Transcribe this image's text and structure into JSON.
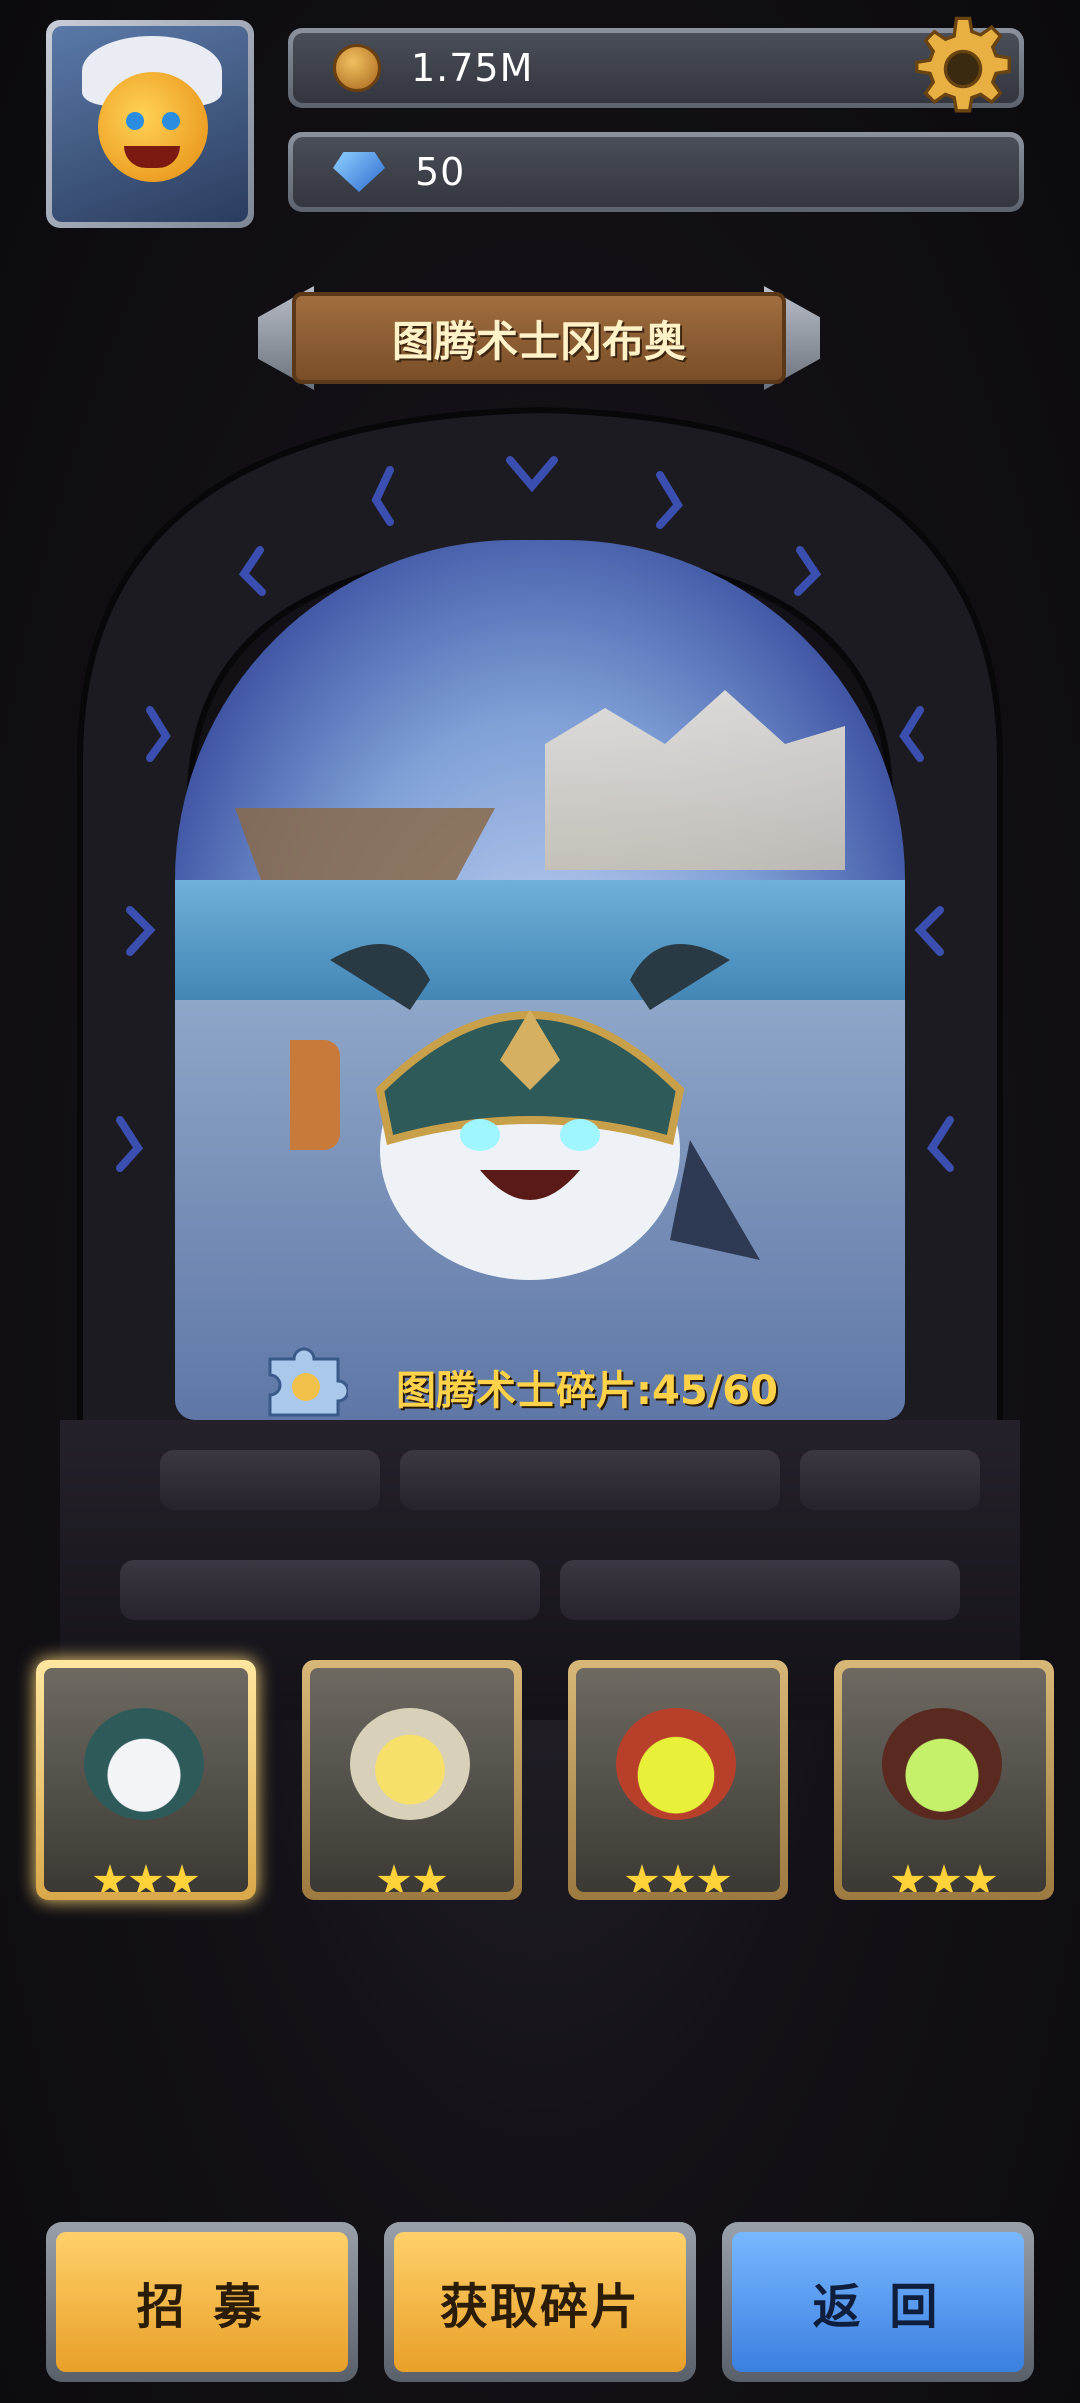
{
  "hud": {
    "coins": "1.75M",
    "gems": "50",
    "icons": {
      "coin": "coin-icon",
      "gem": "gem-icon",
      "settings": "gear-icon"
    }
  },
  "hero": {
    "name": "图腾术士冈布奥",
    "shards_label": "图腾术士碎片:45/60",
    "shards_current": 45,
    "shards_total": 60
  },
  "roster": [
    {
      "stars": 3,
      "selected": true
    },
    {
      "stars": 2,
      "selected": false
    },
    {
      "stars": 3,
      "selected": false
    },
    {
      "stars": 3,
      "selected": false
    }
  ],
  "buttons": {
    "recruit": "招 募",
    "get_shards": "获取碎片",
    "back": "返 回"
  },
  "colors": {
    "gold": "#ffd24a",
    "blue_button": "#3b7fe0",
    "orange_button": "#e8a028"
  }
}
